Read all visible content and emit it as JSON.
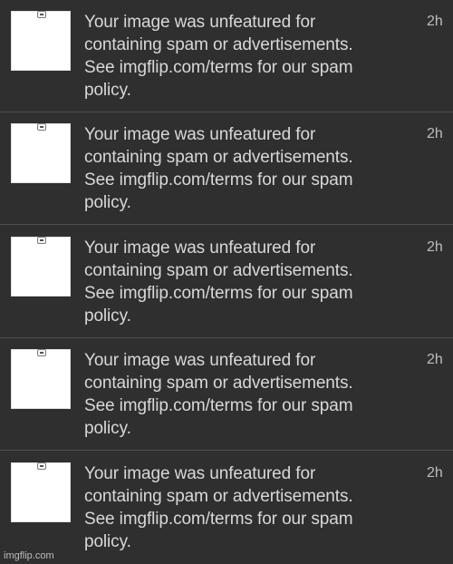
{
  "notifications": [
    {
      "message": "Your image was unfeatured for\ncontaining spam or advertisements.\nSee imgflip.com/terms for our spam\npolicy.",
      "time": "2h",
      "thumbnail_icon": "image-thumbnail-icon",
      "badge_icon": "thumbnail-badge-icon"
    },
    {
      "message": "Your image was unfeatured for\ncontaining spam or advertisements.\nSee imgflip.com/terms for our spam\npolicy.",
      "time": "2h",
      "thumbnail_icon": "image-thumbnail-icon",
      "badge_icon": "thumbnail-badge-icon"
    },
    {
      "message": "Your image was unfeatured for\ncontaining spam or advertisements.\nSee imgflip.com/terms for our spam\npolicy.",
      "time": "2h",
      "thumbnail_icon": "image-thumbnail-icon",
      "badge_icon": "thumbnail-badge-icon"
    },
    {
      "message": "Your image was unfeatured for\ncontaining spam or advertisements.\nSee imgflip.com/terms for our spam\npolicy.",
      "time": "2h",
      "thumbnail_icon": "image-thumbnail-icon",
      "badge_icon": "thumbnail-badge-icon"
    },
    {
      "message": "Your image was unfeatured for\ncontaining spam or advertisements.\nSee imgflip.com/terms for our spam\npolicy.",
      "time": "2h",
      "thumbnail_icon": "image-thumbnail-icon",
      "badge_icon": "thumbnail-badge-icon"
    }
  ],
  "watermark": "imgflip.com",
  "colors": {
    "background": "#2f2f2f",
    "separator": "#4f4f4f",
    "text": "#d8d8d8",
    "time": "#bdbdbd",
    "thumbnail": "#ffffff"
  }
}
